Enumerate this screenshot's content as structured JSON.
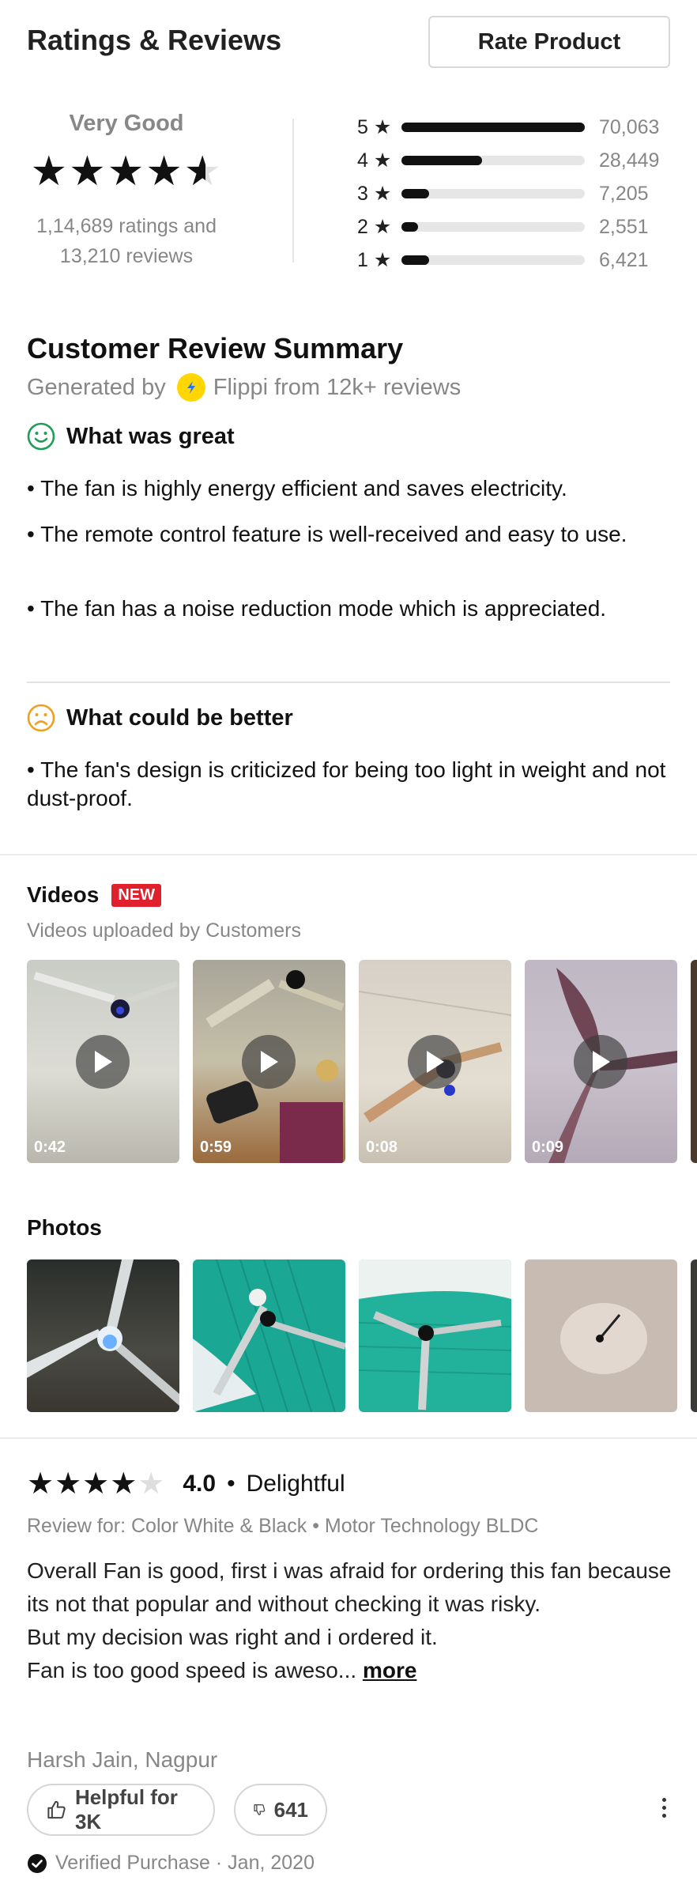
{
  "header": {
    "title": "Ratings & Reviews",
    "rate_button": "Rate Product"
  },
  "overall": {
    "label": "Very Good",
    "stars_value": 4.4,
    "ratings_line1": "1,14,689 ratings and",
    "ratings_line2": "13,210 reviews"
  },
  "distribution": [
    {
      "label": "5 ★",
      "count": "70,063",
      "fraction": 1.0
    },
    {
      "label": "4 ★",
      "count": "28,449",
      "fraction": 0.44
    },
    {
      "label": "3 ★",
      "count": "7,205",
      "fraction": 0.15
    },
    {
      "label": "2 ★",
      "count": "2,551",
      "fraction": 0.09
    },
    {
      "label": "1 ★",
      "count": "6,421",
      "fraction": 0.15
    }
  ],
  "summary": {
    "title": "Customer Review Summary",
    "generated_prefix": "Generated by",
    "generated_suffix": "Flippi from 12k+ reviews",
    "great_heading": "What was great",
    "great_points": [
      "• The fan is highly energy efficient and saves electricity.",
      "• The remote control feature is well-received and easy to use.",
      "• The fan has a noise reduction mode which is appreciated."
    ],
    "better_heading": "What could be better",
    "better_points": [
      "• The fan's design is criticized for being too light in weight and not dust-proof."
    ]
  },
  "videos": {
    "title": "Videos",
    "badge": "NEW",
    "subtitle": "Videos uploaded by Customers",
    "items": [
      {
        "duration": "0:42"
      },
      {
        "duration": "0:59"
      },
      {
        "duration": "0:08"
      },
      {
        "duration": "0:09"
      }
    ]
  },
  "photos": {
    "title": "Photos"
  },
  "review": {
    "stars": 4,
    "score": "4.0",
    "dot": "•",
    "headline": "Delightful",
    "review_for": "Review for: Color White & Black • Motor Technology BLDC",
    "body_line1": "Overall Fan is good, first i was afraid for ordering this fan because its not that popular and without checking it was risky.",
    "body_line2": "But my decision was right and i ordered it.",
    "body_line3": "Fan is too good speed is aweso...",
    "more": "more",
    "author": "Harsh  Jain, Nagpur",
    "helpful": "Helpful for 3K",
    "dislikes": "641",
    "verified": "Verified Purchase · Jan, 2020"
  },
  "colors": {
    "accent_new": "#e0202c",
    "great": "#1f9c57",
    "better": "#f0a020",
    "flippi": "#ffd600"
  }
}
